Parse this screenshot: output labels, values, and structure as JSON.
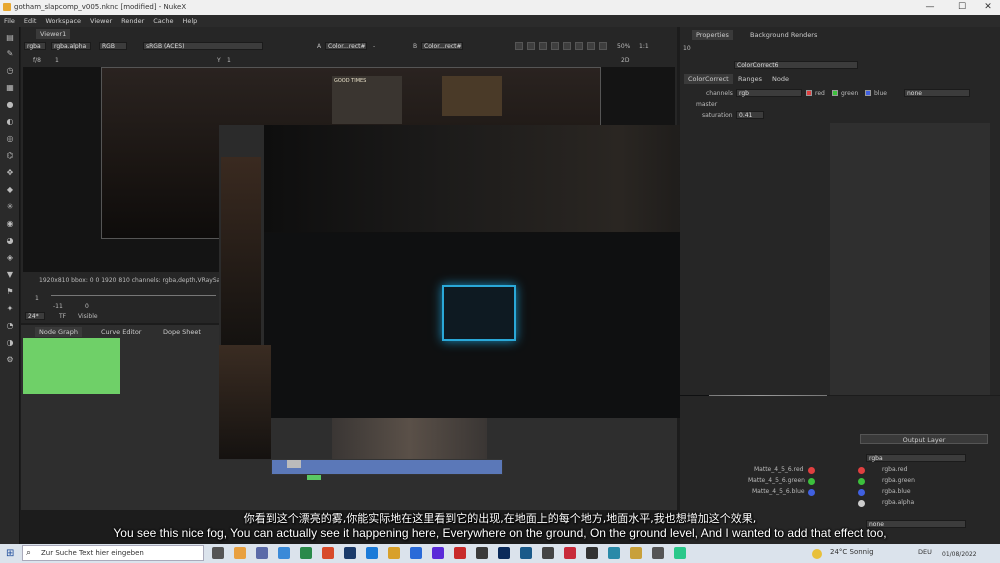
{
  "window": {
    "title": "gotham_slapcomp_v005.nknc [modified] - NukeX",
    "min": "—",
    "max": "☐",
    "close": "✕"
  },
  "menu": [
    "File",
    "Edit",
    "Workspace",
    "Viewer",
    "Render",
    "Cache",
    "Help"
  ],
  "viewer": {
    "tab": "Viewer1",
    "channels": "rgba",
    "alpha": "rgba.alpha",
    "rgb": "RGB",
    "colorspace": "sRGB (ACES)",
    "a_label": "A",
    "a_input": "Color...rect#",
    "a_dash": "-",
    "b_label": "B",
    "b_input": "Color...rect#",
    "zoom": "50%",
    "ratio": "1:1",
    "frame_label": "f/8",
    "frame_val": "1",
    "y_label": "Y",
    "y_val": "1",
    "view_mode": "2D",
    "info": "1920x810  bbox: 0 0 1920 810 channels: rgba,depth,VRaySam",
    "tl_start": "-11",
    "tl_zero": "0",
    "tl_frame": "1",
    "fps": "24*",
    "tf": "TF",
    "visible": "Visible",
    "sign_text": "GOOD TIMES"
  },
  "node_tabs": [
    "Node Graph",
    "Curve Editor",
    "Dope Sheet"
  ],
  "properties": {
    "tab1": "Properties",
    "tab2": "Background Renders",
    "count": "10",
    "node_name": "ColorCorrect6",
    "subtabs": [
      "ColorCorrect",
      "Ranges",
      "Node"
    ],
    "channels_label": "channels",
    "channels_val": "rgb",
    "red": "red",
    "green": "green",
    "blue": "blue",
    "none": "none",
    "master": "master",
    "saturation_label": "saturation",
    "saturation_val": "0.41",
    "output_layer": "Output Layer",
    "layer_val": "rgba",
    "matte_rows": [
      "Matte_4_5_6.red",
      "Matte_4_5_6.green",
      "Matte_4_5_6.blue"
    ],
    "out_rows": [
      "rgba.red",
      "rgba.green",
      "rgba.blue",
      "rgba.alpha"
    ],
    "bottom_none": "none"
  },
  "subtitles": {
    "zh": "你看到这个漂亮的雾,你能实际地在这里看到它的出现,在地面上的每个地方,地面水平,我也想增加这个效果,",
    "en": "You see this nice fog, You can actually see it happening here, Everywhere on the ground, On the ground level, And I wanted to add that effect too,"
  },
  "taskbar": {
    "search_placeholder": "Zur Suche Text hier eingeben",
    "weather": "24°C  Sonnig",
    "lang": "DEU",
    "date": "01/08/2022"
  },
  "colors": {
    "accent": "#5ac864",
    "node_blue": "#5b78b8",
    "red": "#e04040",
    "green": "#3cc03c",
    "blue": "#4060e0"
  }
}
